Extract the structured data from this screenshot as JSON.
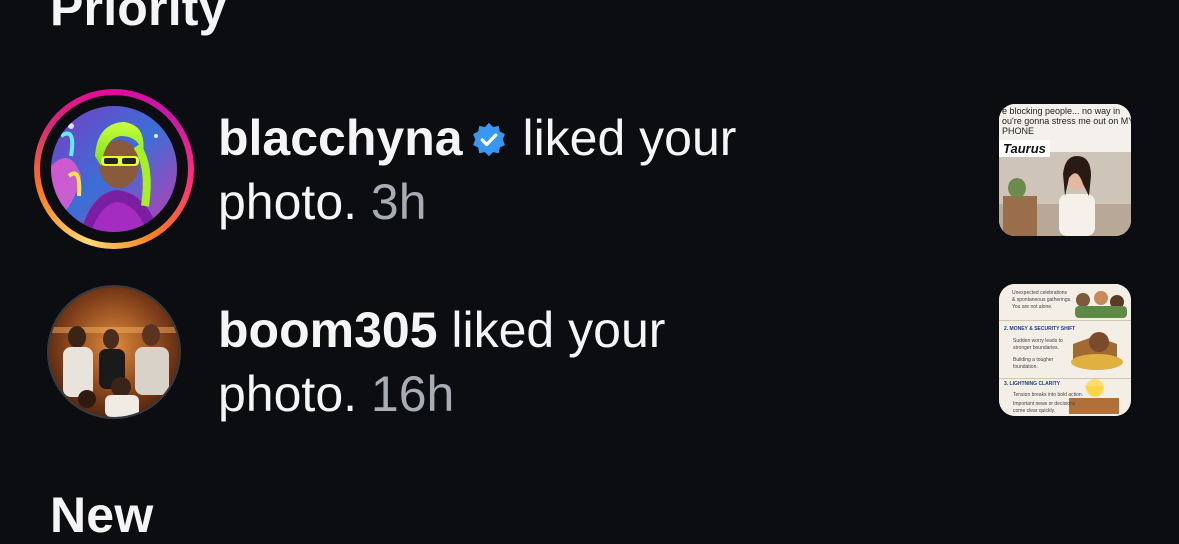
{
  "sections": {
    "priority": "Priority",
    "new": "New"
  },
  "colors": {
    "background": "#0b0d11",
    "text_primary": "#f5f5f5",
    "text_secondary": "#a8adb5",
    "verified_badge": "#3897f0"
  },
  "notifications": [
    {
      "username": "blacchyna",
      "verified": true,
      "has_story_ring": true,
      "action": " liked your photo.",
      "time": "3h",
      "thumbnail": {
        "caption_lines": [
          "e blocking people... no way in",
          "ou're gonna stress me out on MY",
          "PHONE"
        ],
        "tag": "Taurus"
      }
    },
    {
      "username": "boom305",
      "verified": false,
      "has_story_ring": false,
      "action": " liked your photo.",
      "time": "16h",
      "thumbnail": {
        "lines": [
          "Unexpected celebrations",
          "& spontaneous gatherings.",
          "You are not alone."
        ],
        "heading_2": "2. MONEY & SECURITY SHIFT",
        "lines_2": [
          "Sudden worry leads to",
          "stronger boundaries.",
          "Building a tougher",
          "foundation."
        ],
        "heading_3": "3. LIGHTNING CLARITY",
        "lines_3": [
          "Tension breaks into bold action.",
          "Important news or decisions",
          "come clear quickly."
        ]
      }
    }
  ]
}
